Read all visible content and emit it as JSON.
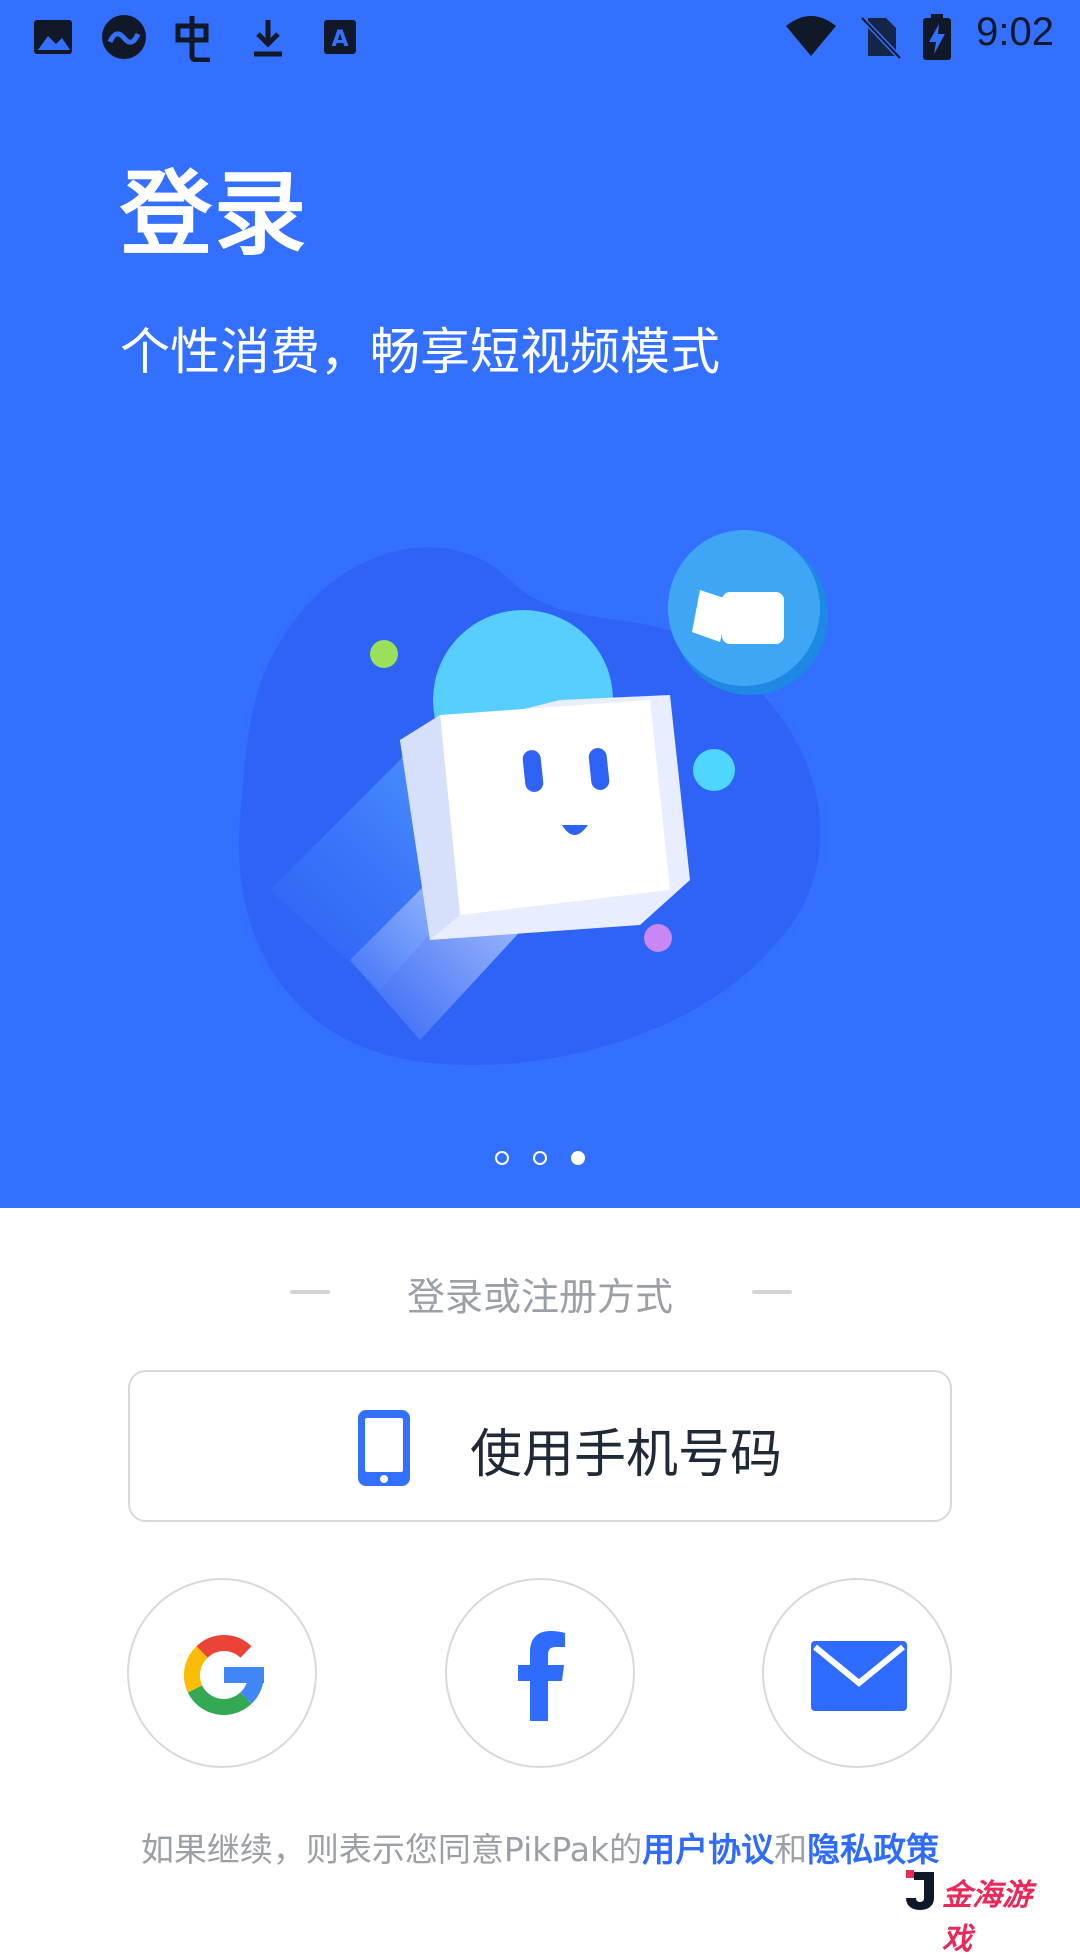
{
  "status_bar": {
    "time": "9:02",
    "left_icons": [
      "image-icon",
      "cloud-link-icon",
      "app-icon",
      "download-icon",
      "translate-icon"
    ],
    "right_icons": [
      "wifi-icon",
      "no-sim-icon",
      "battery-charging-icon"
    ]
  },
  "hero": {
    "title": "登录",
    "subtitle": "个性消费，畅享短视频模式",
    "background": "#3370FF",
    "page_indicator": {
      "count": 3,
      "active_index": 2
    }
  },
  "login": {
    "divider_text": "登录或注册方式",
    "phone_button_label": "使用手机号码",
    "social_buttons": [
      "google-icon",
      "facebook-icon",
      "email-icon"
    ]
  },
  "terms": {
    "prefix": "如果继续，则表示您同意PikPak的",
    "user_agreement": "用户协议",
    "conjunction": "和",
    "privacy_policy": "隐私政策"
  },
  "watermark": {
    "text": "金海游戏"
  }
}
